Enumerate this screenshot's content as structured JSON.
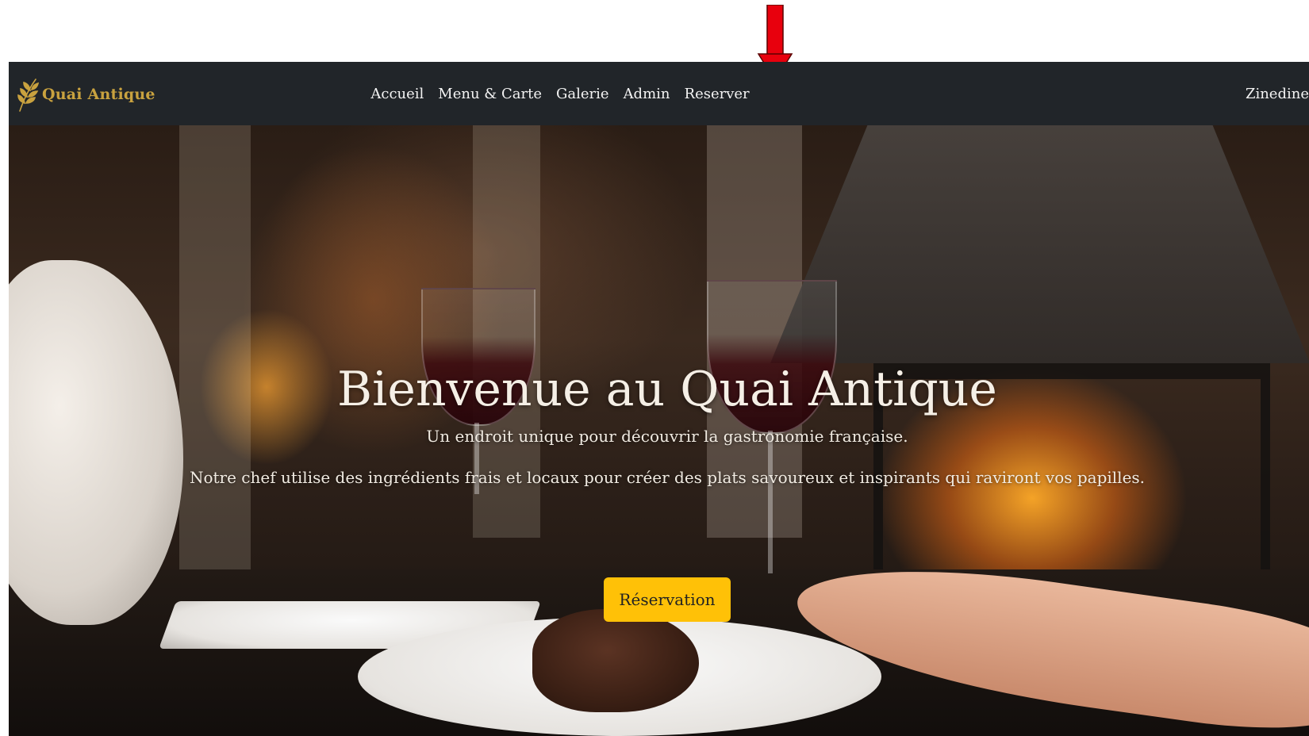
{
  "brand": {
    "name": "Quai Antique",
    "color": "#c9a23f"
  },
  "nav": {
    "links": [
      "Accueil",
      "Menu & Carte",
      "Galerie",
      "Admin",
      "Reserver"
    ],
    "user": "Zinedine"
  },
  "hero": {
    "title": "Bienvenue au Quai Antique",
    "subtitle": "Un endroit unique pour découvrir la gastronomie française.",
    "text": "Notre chef utilise des ingrédients frais et locaux pour créer des plats savoureux et inspirants qui raviront vos papilles.",
    "cta_label": "Réservation",
    "cta_color": "#ffc107"
  },
  "annotation": {
    "arrow_color": "#e8000d",
    "icon": "red-down-arrow-icon"
  },
  "colors": {
    "navbar": "#212529",
    "nav_text": "#f3f3f3"
  }
}
